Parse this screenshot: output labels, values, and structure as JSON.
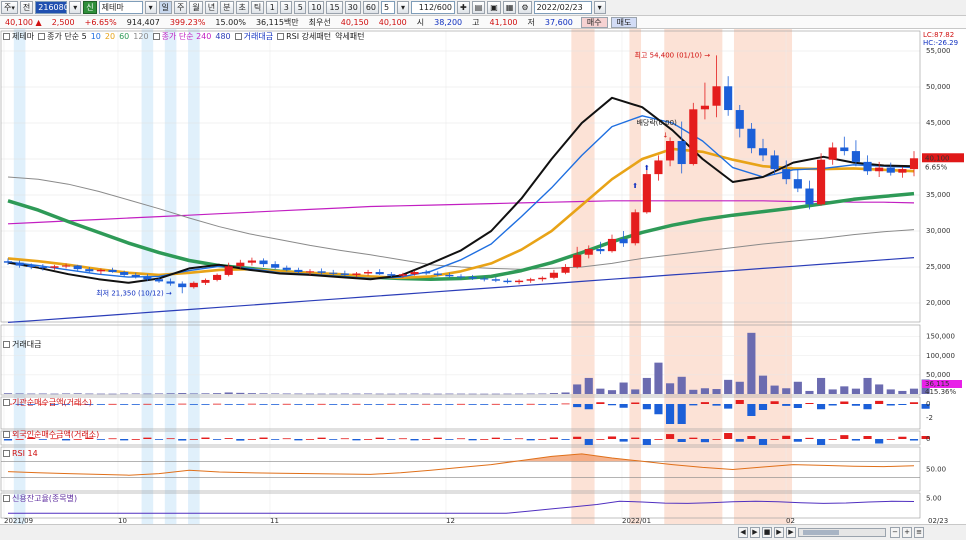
{
  "toolbar": {
    "period_label": "주",
    "period_caret": "▾",
    "mode_label": "전",
    "code_value": "216080",
    "code_caret": "▾",
    "market_badge": "신",
    "stock_name": "제테마",
    "name_caret": "▾",
    "timeframes": [
      "일",
      "주",
      "월",
      "년",
      "분",
      "초",
      "틱"
    ],
    "minutes": [
      "1",
      "3",
      "5",
      "10",
      "15",
      "30",
      "60"
    ],
    "count_value": "5",
    "count_caret": "▾",
    "range_value": "112/600",
    "date_value": "2022/02/23",
    "date_caret": "▾"
  },
  "quote": {
    "price": "40,100",
    "change_arrow": "▲",
    "change": "2,500",
    "change_pct": "+6.65%",
    "volume": "914,407",
    "volume_ratio": "399.23%",
    "turnover_pct": "15.00%",
    "trade_value": "36,115백만",
    "best_ask_label": "최우선",
    "best_ask": "40,150",
    "best_bid": "40,100",
    "open_label": "시",
    "open": "38,200",
    "high_label": "고",
    "high": "41,100",
    "low_label": "저",
    "low": "37,600",
    "buy_label": "매수",
    "sell_label": "매도"
  },
  "main_legend": {
    "stock": "제테마",
    "ma_title": "종가 단순 5",
    "ma_periods": [
      {
        "label": "10",
        "color": "#1f6fe0"
      },
      {
        "label": "20",
        "color": "#e8a317"
      },
      {
        "label": "60",
        "color": "#2e9a57"
      },
      {
        "label": "120",
        "color": "#8a8a8a"
      }
    ],
    "ma_long_title": "종가 단순 240",
    "ma_long_second": "480",
    "ma_long_second_color": "#2b3db8",
    "ma_long_color": "#c21fc2",
    "volume_label": "거래대금",
    "rsi_label": "RSI 강세패턴",
    "rsi_weak_label": "약세패턴",
    "lc": "LC:87.82",
    "hc": "HC:-26.29"
  },
  "price_axis": {
    "ticks": [
      "55,000",
      "50,000",
      "45,000",
      "40,000",
      "35,000",
      "30,000",
      "25,000",
      "20,000"
    ],
    "current_price": "40,100",
    "current_pct": "6.65%"
  },
  "annotations": {
    "high": "최고 54,400 (01/10)",
    "low": "최저 21,350 (10/12)",
    "dividend": "배당락(0.00)"
  },
  "volume_panel": {
    "label": "거래대금",
    "ticks": [
      "150,000",
      "100,000",
      "50,000"
    ],
    "current": "36,115",
    "current_pct": "415.36%"
  },
  "inst_panel": {
    "label": "기관순매수금액(거래소)",
    "ticks": [
      "0",
      "-2"
    ]
  },
  "foreign_panel": {
    "label": "외국인순매수금액(거래소)",
    "ticks": [
      "0"
    ]
  },
  "rsi_panel": {
    "label": "RSI 14",
    "ticks": [
      "50.00"
    ]
  },
  "credit_panel": {
    "label": "신용잔고율(종목별)",
    "ticks": [
      "5.00"
    ]
  },
  "x_axis": {
    "labels": [
      "2021/09",
      "10",
      "11",
      "12",
      "2022/01",
      "02"
    ],
    "end_label": "02/23"
  },
  "chart_data": {
    "type": "candlestick",
    "x_range": [
      "2021-09-01",
      "2022-02-23"
    ],
    "y_range": [
      17500,
      57500
    ],
    "candles": [
      [
        25800,
        26200,
        25300,
        25600
      ],
      [
        25600,
        25900,
        24900,
        25200
      ],
      [
        25200,
        25500,
        24700,
        25000
      ],
      [
        25000,
        25400,
        24500,
        24900
      ],
      [
        24900,
        25300,
        24600,
        25100
      ],
      [
        25100,
        25500,
        24800,
        25200
      ],
      [
        25200,
        25300,
        24500,
        24700
      ],
      [
        24700,
        25000,
        24200,
        24400
      ],
      [
        24400,
        24800,
        24000,
        24600
      ],
      [
        24600,
        24900,
        24200,
        24300
      ],
      [
        24300,
        24500,
        23700,
        23900
      ],
      [
        23900,
        24200,
        23400,
        23600
      ],
      [
        23600,
        24000,
        23100,
        23300
      ],
      [
        23300,
        23600,
        22800,
        23000
      ],
      [
        23000,
        23400,
        22400,
        22700
      ],
      [
        22700,
        23000,
        21350,
        22200
      ],
      [
        22200,
        23000,
        22000,
        22800
      ],
      [
        22800,
        23400,
        22500,
        23200
      ],
      [
        23200,
        24100,
        23000,
        23900
      ],
      [
        23900,
        25600,
        23700,
        25100
      ],
      [
        25100,
        26000,
        24800,
        25600
      ],
      [
        25600,
        26300,
        25200,
        25900
      ],
      [
        25900,
        26200,
        25000,
        25400
      ],
      [
        25400,
        25800,
        24700,
        24900
      ],
      [
        24900,
        25200,
        24400,
        24600
      ],
      [
        24600,
        24900,
        24100,
        24300
      ],
      [
        24300,
        24700,
        23900,
        24400
      ],
      [
        24400,
        24800,
        24000,
        24200
      ],
      [
        24200,
        24600,
        23900,
        24100
      ],
      [
        24100,
        24500,
        23700,
        23900
      ],
      [
        23900,
        24300,
        23600,
        24100
      ],
      [
        24100,
        24600,
        23800,
        24300
      ],
      [
        24300,
        24700,
        23900,
        24000
      ],
      [
        24000,
        24300,
        23600,
        23800
      ],
      [
        23800,
        24200,
        23500,
        24000
      ],
      [
        24000,
        24500,
        23800,
        24300
      ],
      [
        24300,
        24600,
        23900,
        24100
      ],
      [
        24100,
        24400,
        23700,
        23900
      ],
      [
        23900,
        24200,
        23500,
        23700
      ],
      [
        23700,
        24000,
        23300,
        23600
      ],
      [
        23600,
        23900,
        23200,
        23400
      ],
      [
        23400,
        23700,
        23000,
        23300
      ],
      [
        23300,
        23600,
        22900,
        23100
      ],
      [
        23100,
        23400,
        22700,
        22900
      ],
      [
        22900,
        23300,
        22600,
        23100
      ],
      [
        23100,
        23500,
        22800,
        23300
      ],
      [
        23300,
        23700,
        23000,
        23500
      ],
      [
        23500,
        24600,
        23300,
        24200
      ],
      [
        24200,
        25400,
        24000,
        25000
      ],
      [
        25000,
        27800,
        24800,
        26700
      ],
      [
        26700,
        28000,
        26200,
        27500
      ],
      [
        27500,
        28500,
        26800,
        27200
      ],
      [
        27200,
        29500,
        27000,
        28900
      ],
      [
        28900,
        30000,
        27800,
        28300
      ],
      [
        28300,
        33000,
        28000,
        32600
      ],
      [
        32600,
        38500,
        32400,
        37900
      ],
      [
        37900,
        40500,
        37000,
        39800
      ],
      [
        39800,
        43000,
        39000,
        42500
      ],
      [
        42500,
        45200,
        38000,
        39300
      ],
      [
        39300,
        47800,
        39100,
        46900
      ],
      [
        46900,
        50600,
        45500,
        47400
      ],
      [
        47400,
        54400,
        45800,
        50100
      ],
      [
        50100,
        51500,
        46000,
        46800
      ],
      [
        46800,
        47500,
        43000,
        44200
      ],
      [
        44200,
        45000,
        40800,
        41500
      ],
      [
        41500,
        42800,
        39700,
        40500
      ],
      [
        40500,
        41200,
        37800,
        38600
      ],
      [
        38600,
        39800,
        36500,
        37200
      ],
      [
        37200,
        38600,
        35400,
        35900
      ],
      [
        35900,
        37000,
        33000,
        33700
      ],
      [
        33700,
        40800,
        33500,
        39900
      ],
      [
        39900,
        42300,
        39200,
        41600
      ],
      [
        41600,
        43100,
        40500,
        41100
      ],
      [
        41100,
        42600,
        39000,
        39600
      ],
      [
        39600,
        40500,
        37800,
        38300
      ],
      [
        38300,
        39600,
        37500,
        38800
      ],
      [
        38800,
        39500,
        37700,
        38100
      ],
      [
        38100,
        38900,
        37400,
        38600
      ],
      [
        38600,
        41100,
        37600,
        40100
      ]
    ],
    "ma_values": {
      "ma5": [
        25600,
        24900,
        24000,
        23300,
        22800,
        23400,
        24800,
        25300,
        24600,
        24100,
        23900,
        23600,
        23300,
        23800,
        25500,
        27300,
        30000,
        34500,
        40000,
        45000,
        48500,
        47200,
        44000,
        40000,
        36800,
        37500,
        39500,
        40300,
        39500,
        39100,
        39000
      ],
      "ma10": [
        25700,
        25200,
        24600,
        24000,
        23600,
        23700,
        24500,
        25100,
        24800,
        24200,
        24000,
        23700,
        23400,
        23600,
        24400,
        26000,
        28200,
        32000,
        36000,
        40500,
        44500,
        46000,
        45000,
        42500,
        38800,
        37500,
        38500,
        38700,
        39200,
        39000,
        38800
      ],
      "ma20": [
        26200,
        25800,
        25300,
        24700,
        24200,
        23900,
        24200,
        24600,
        24700,
        24400,
        24200,
        24000,
        23700,
        23500,
        23700,
        24400,
        25500,
        27400,
        30000,
        33600,
        37200,
        40000,
        41400,
        41000,
        39900,
        39000,
        38700,
        38600,
        38700,
        38500,
        38300
      ],
      "ma60": [
        34200,
        32900,
        31300,
        29800,
        28300,
        27000,
        25900,
        25200,
        24800,
        24400,
        24100,
        23800,
        23600,
        23400,
        23300,
        23400,
        23700,
        24500,
        25600,
        27000,
        28500,
        29800,
        30800,
        31600,
        32200,
        32700,
        33200,
        33800,
        34400,
        34800,
        35200
      ],
      "ma120": [
        37500,
        37200,
        36500,
        35500,
        34300,
        33100,
        31800,
        30600,
        29600,
        28800,
        28000,
        27300,
        26700,
        26000,
        25300,
        25000,
        24800,
        24700,
        24800,
        25000,
        25500,
        26200,
        26700,
        27200,
        27700,
        28200,
        28600,
        29000,
        29500,
        29900,
        30200
      ],
      "ma240": [
        31000,
        31200,
        31400,
        31600,
        31800,
        32000,
        32200,
        32400,
        32600,
        32800,
        33000,
        33200,
        33400,
        33500,
        33600,
        33700,
        33800,
        33900,
        34000,
        34100,
        34200,
        34200,
        34200,
        34200,
        34200,
        34200,
        34100,
        34100,
        34000,
        34000,
        33900
      ],
      "ma480": [
        17300,
        17600,
        17900,
        18200,
        18500,
        18800,
        19100,
        19400,
        19700,
        20000,
        20300,
        20600,
        20900,
        21200,
        21500,
        21800,
        22100,
        22400,
        22700,
        23000,
        23300,
        23600,
        23900,
        24200,
        24500,
        24800,
        25100,
        25400,
        25700,
        26000,
        26300
      ]
    },
    "volume": [
      2000,
      1500,
      1200,
      1300,
      1000,
      1500,
      1800,
      1200,
      1000,
      900,
      1300,
      1400,
      1200,
      1500,
      1900,
      2500,
      1500,
      1800,
      2200,
      4000,
      3000,
      2200,
      1800,
      1500,
      1300,
      1200,
      1100,
      1000,
      1000,
      1200,
      1100,
      1300,
      1000,
      900,
      1100,
      1200,
      1000,
      900,
      1100,
      1000,
      900,
      800,
      900,
      1000,
      1100,
      1200,
      1300,
      2500,
      4000,
      25000,
      42000,
      14000,
      10000,
      30000,
      12000,
      42000,
      82000,
      28000,
      45000,
      11000,
      15000,
      13000,
      37000,
      32000,
      160000,
      48000,
      22000,
      15000,
      32000,
      8000,
      42000,
      12000,
      20000,
      14000,
      42000,
      25000,
      12000,
      8000,
      14000,
      38000
    ],
    "rsi": [
      45,
      42,
      40,
      38,
      36,
      40,
      48,
      44,
      42,
      41,
      40,
      39,
      38,
      42,
      48,
      55,
      62,
      72,
      82,
      88,
      78,
      70,
      62,
      55,
      50,
      56,
      62,
      60,
      58,
      57,
      59
    ]
  }
}
